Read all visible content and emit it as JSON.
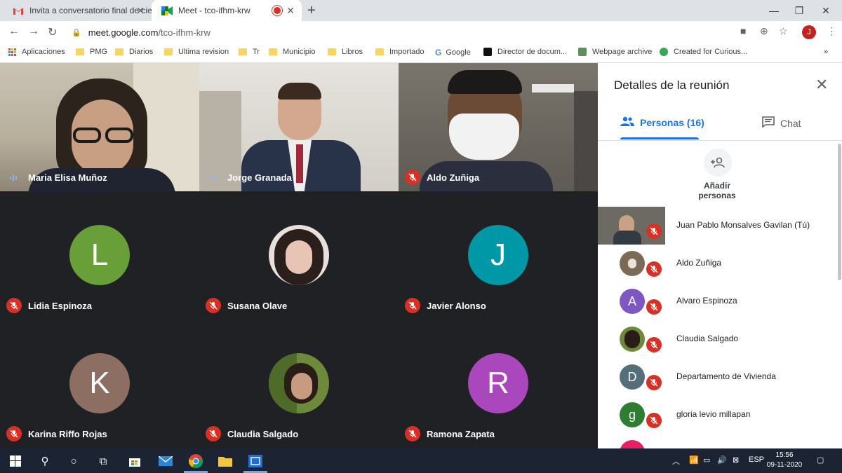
{
  "browser": {
    "tabs": [
      {
        "title": "Invita a conversatorio final de cie",
        "active": false
      },
      {
        "title": "Meet - tco-ifhm-krw",
        "active": true
      }
    ],
    "url_host": "meet.google.com",
    "url_path": "/tco-ifhm-krw",
    "profile_initial": "J",
    "bookmarks": [
      "Aplicaciones",
      "PMG",
      "Diarios",
      "Ultima revision",
      "Tr",
      "Municipio",
      "Libros",
      "Importado",
      "Google",
      "Director de docum...",
      "Webpage archive",
      "Created for Curious..."
    ]
  },
  "meet": {
    "video_tiles": [
      {
        "name": "Maria Elisa Muñoz",
        "indicator": "speaking"
      },
      {
        "name": "Jorge Granada",
        "indicator": "more"
      },
      {
        "name": "Aldo Zuñiga",
        "indicator": "muted"
      }
    ],
    "avatar_tiles": [
      {
        "name": "Lidia Espinoza",
        "initial": "L",
        "color": "#689f38"
      },
      {
        "name": "Susana Olave",
        "initial": "",
        "color": "#d9c7c0"
      },
      {
        "name": "Javier Alonso",
        "initial": "J",
        "color": "#0097a7"
      },
      {
        "name": "Karina Riffo Rojas",
        "initial": "K",
        "color": "#8d6e63"
      },
      {
        "name": "Claudia Salgado",
        "initial": "",
        "color": "#6d8a3a"
      },
      {
        "name": "Ramona Zapata",
        "initial": "R",
        "color": "#ab47bc"
      }
    ]
  },
  "panel": {
    "title": "Detalles de la reunión",
    "people_tab": "Personas (16)",
    "chat_tab": "Chat",
    "add_people_line1": "Añadir",
    "add_people_line2": "personas",
    "participants": [
      {
        "name": "Juan Pablo Monsalves Gavilan (Tú)",
        "initial": "",
        "color": "#6d6a64"
      },
      {
        "name": "Aldo Zuñiga",
        "initial": "",
        "color": "#7b6a55"
      },
      {
        "name": "Alvaro Espinoza",
        "initial": "A",
        "color": "#7e57c2"
      },
      {
        "name": "Claudia Salgado",
        "initial": "",
        "color": "#6d8a3a"
      },
      {
        "name": "Departamento de Vivienda",
        "initial": "D",
        "color": "#546e7a"
      },
      {
        "name": "gloria levio millapan",
        "initial": "g",
        "color": "#2e7d32"
      }
    ]
  },
  "taskbar": {
    "language": "ESP",
    "time": "15:56",
    "date": "09-11-2020"
  },
  "colors": {
    "meet_blue": "#1a73e8",
    "muted_red": "#d93025",
    "meet_bg": "#202124",
    "taskbar": "#1c2434"
  }
}
